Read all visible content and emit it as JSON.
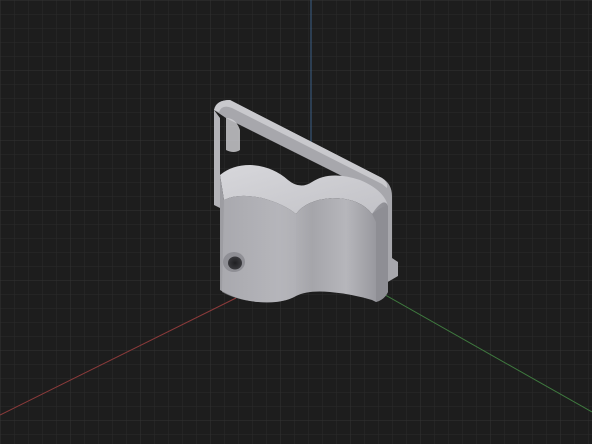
{
  "viewport": {
    "background_color": "#1d1d1d",
    "grid": {
      "visible": true,
      "minor_color": "#2a2a2a",
      "major_color": "#333333"
    },
    "axes": {
      "x_color": "#8b3a3a",
      "y_color": "#3f7a3f",
      "z_color": "#3a5f86"
    },
    "model": {
      "description_icon": "wall-hook-bracket-icon",
      "color_light": "#cfcfd3",
      "color_mid": "#a9a9ae",
      "color_dark": "#7f7f85",
      "hole_color": "#2b2b2e"
    }
  }
}
